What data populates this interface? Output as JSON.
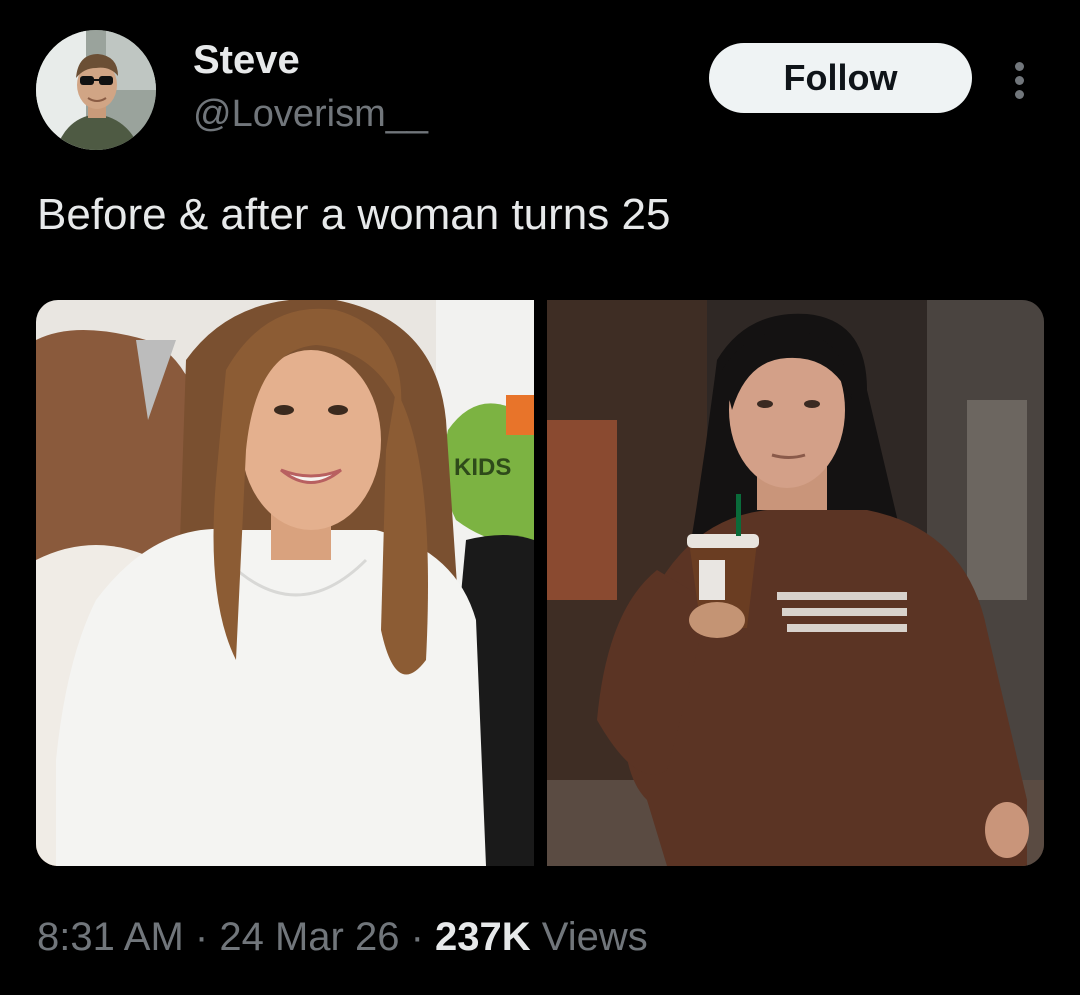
{
  "author": {
    "display_name": "Steve",
    "handle": "@Loverism__",
    "avatar_icon": "profile-photo-man-sunglasses"
  },
  "actions": {
    "follow_label": "Follow",
    "more_icon": "more-vertical-icon"
  },
  "tweet": {
    "text": "Before & after a woman turns 25"
  },
  "media": {
    "photos": [
      {
        "icon": "photo-woman-long-brown-hair-white-top"
      },
      {
        "icon": "photo-woman-dark-hair-brown-sweater-iced-coffee"
      }
    ],
    "sign_text": "KIDS"
  },
  "meta": {
    "time": "8:31 AM",
    "separator": "·",
    "date": "24 Mar 26",
    "views_count": "237K",
    "views_label": "Views"
  },
  "colors": {
    "background": "#000000",
    "primary_text": "#e7e9ea",
    "secondary_text": "#71767b",
    "follow_bg": "#eff3f4",
    "follow_text": "#0f1419"
  }
}
